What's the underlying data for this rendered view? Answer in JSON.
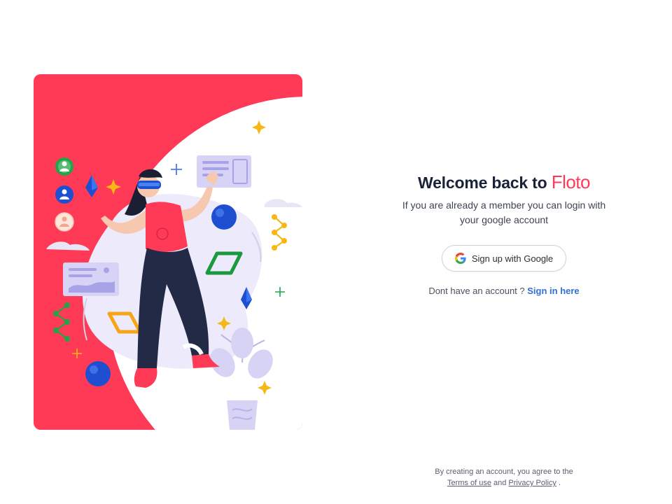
{
  "colors": {
    "brand": "#ff3a57",
    "heading": "#1a2238",
    "link": "#2f6fd6",
    "panel_bg": "#ffffff"
  },
  "hero": {
    "icon_name": "vr-woman-illustration"
  },
  "login": {
    "title_prefix": "Welcome back to",
    "brand": "Floto",
    "subtitle": "If you are already a member you can login with your google account",
    "google_button_label": "Sign up with Google",
    "google_icon": "google-icon",
    "no_account_text": "Dont have an account ?",
    "signin_link_label": "Sign in here"
  },
  "footer": {
    "terms_intro": "By creating an account, you agree to the",
    "terms_link": "Terms of use",
    "and_text": "and",
    "privacy_link": "Privacy Policy",
    "end_punct": "."
  }
}
